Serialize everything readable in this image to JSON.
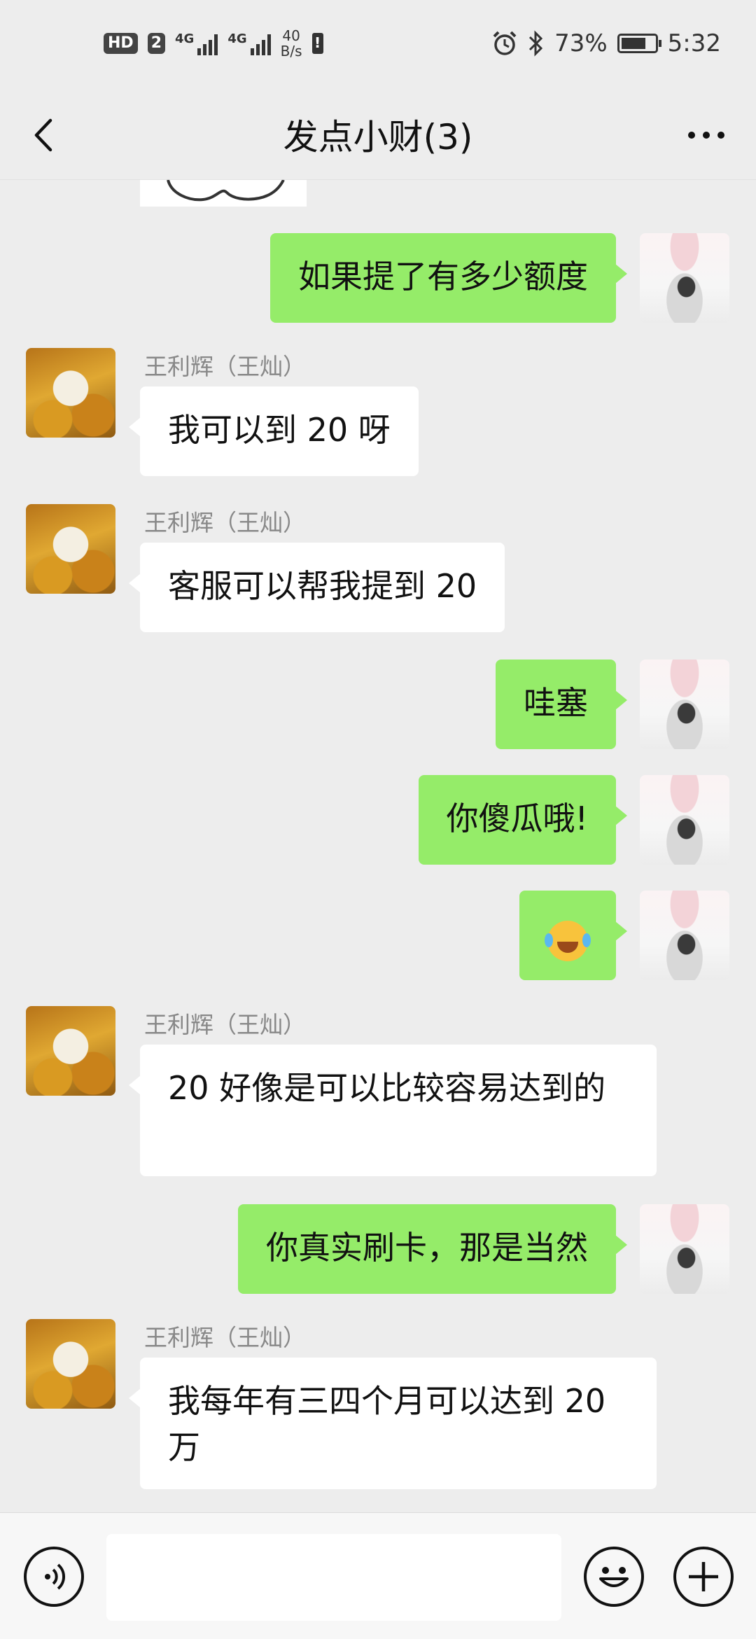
{
  "status_bar": {
    "hd_label": "HD",
    "sim_badge": "2",
    "network_1": "4G",
    "network_2": "4G",
    "net_speed_value": "40",
    "net_speed_unit": "B/s",
    "battery_percent": "73%",
    "battery_level": 0.73,
    "time": "5:32"
  },
  "header": {
    "title": "发点小财(3)"
  },
  "messages": [
    {
      "side": "right",
      "text": "如果提了有多少额度"
    },
    {
      "side": "left",
      "sender": "王利辉（王灿）",
      "text": "我可以到 20 呀"
    },
    {
      "side": "left",
      "sender": "王利辉（王灿）",
      "text": "客服可以帮我提到 20"
    },
    {
      "side": "right",
      "text": "哇塞"
    },
    {
      "side": "right",
      "text": "你傻瓜哦!"
    },
    {
      "side": "right",
      "emoji": "facepalm-laugh-cry-icon"
    },
    {
      "side": "left",
      "sender": "王利辉（王灿）",
      "text": "20 好像是可以比较容易达到的"
    },
    {
      "side": "right",
      "text": "你真实刷卡，那是当然"
    },
    {
      "side": "left",
      "sender": "王利辉（王灿）",
      "text": "我每年有三四个月可以达到 20 万"
    }
  ],
  "input_bar": {
    "value": "",
    "placeholder": ""
  },
  "colors": {
    "outgoing_bubble": "#95ec69",
    "incoming_bubble": "#ffffff",
    "background": "#ededed"
  }
}
